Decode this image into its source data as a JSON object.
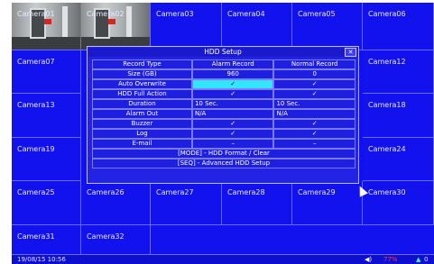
{
  "cameras": [
    "Camera01",
    "Camera02",
    "Camera03",
    "Camera04",
    "Camera05",
    "Camera06",
    "Camera07",
    "Camera12",
    "Camera13",
    "Camera18",
    "Camera19",
    "Camera24",
    "Camera25",
    "Camera26",
    "Camera27",
    "Camera28",
    "Camera29",
    "Camera30",
    "Camera31",
    "Camera32"
  ],
  "dialog": {
    "title": "HDD Setup",
    "close": "✕",
    "header": [
      "Record Type",
      "Alarm Record",
      "Normal Record"
    ],
    "rows": [
      {
        "label": "Size (GB)",
        "alarm": "960",
        "normal": "0"
      },
      {
        "label": "Auto Overwrite",
        "alarm": "✓",
        "normal": "✓"
      },
      {
        "label": "HDD Full Action",
        "alarm": "✓",
        "normal": "✓"
      },
      {
        "label": "Duration",
        "alarm": "10 Sec.",
        "normal": "10 Sec."
      },
      {
        "label": "Alarm Out",
        "alarm": "N/A",
        "normal": "N/A"
      },
      {
        "label": "Buzzer",
        "alarm": "✓",
        "normal": "✓"
      },
      {
        "label": "Log",
        "alarm": "✓",
        "normal": "✓"
      },
      {
        "label": "E-mail",
        "alarm": "–",
        "normal": "–"
      }
    ],
    "footer1": "[MODE] - HDD Format / Clear",
    "footer2": "[SEQ] - Advanced HDD Setup"
  },
  "status": {
    "datetime": "19/08/15 10:56",
    "speaker": "◀)",
    "hdd_percent": "77%",
    "net_icon": "▲",
    "net_value": "0"
  }
}
